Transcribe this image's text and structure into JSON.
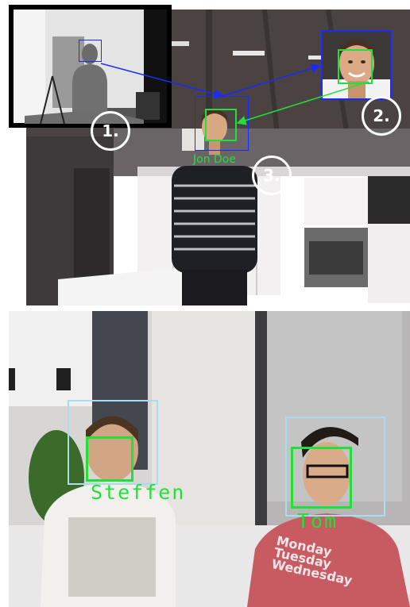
{
  "top_figure": {
    "step_labels": [
      "1.",
      "2.",
      "3."
    ],
    "person_label": "Jon Doe",
    "colors": {
      "blue_box": "#1a2bff",
      "green_box": "#22e03a",
      "step_circle": "#ffffff"
    }
  },
  "bottom_figure": {
    "person_labels": [
      "Steffen",
      "Tom"
    ],
    "shirt_text": [
      "Monday",
      "Tuesday",
      "Wednesday"
    ],
    "colors": {
      "body_box": "#a8dcf0",
      "face_box": "#22e03a"
    }
  }
}
